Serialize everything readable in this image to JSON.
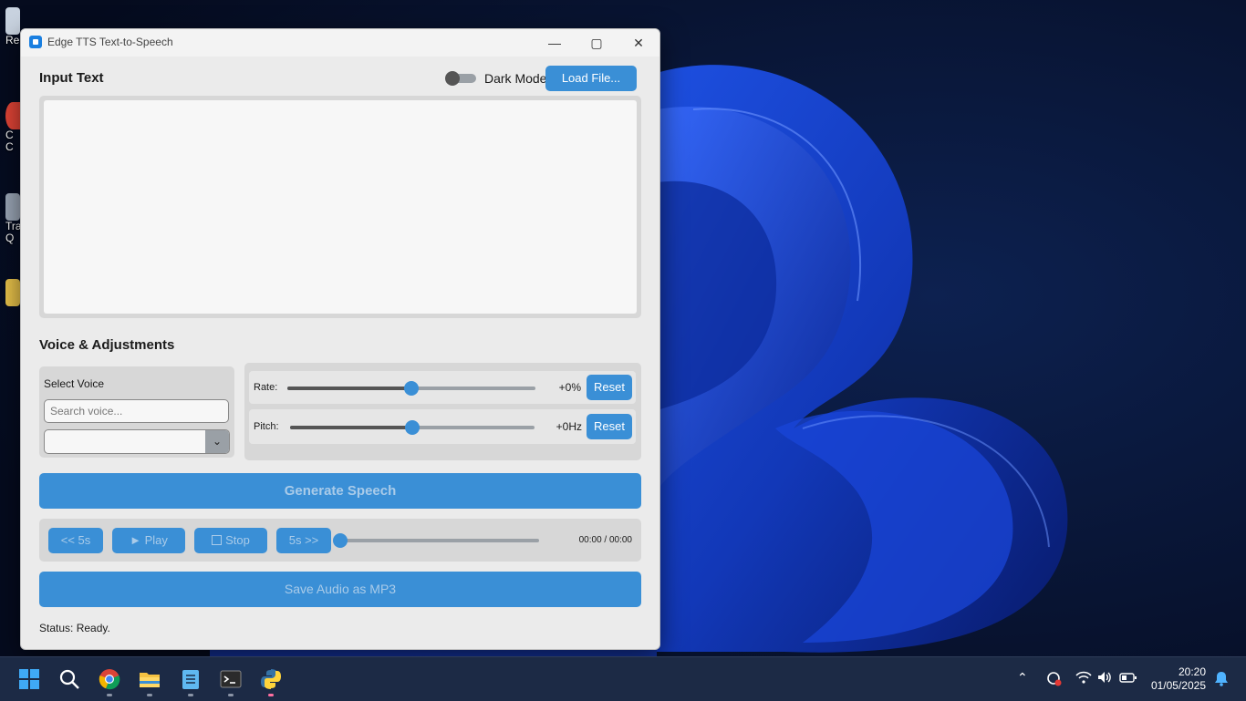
{
  "window": {
    "title": "Edge TTS Text-to-Speech",
    "minimize_glyph": "—",
    "maximize_glyph": "▢",
    "close_glyph": "✕"
  },
  "input_section": {
    "title": "Input Text",
    "dark_mode_label": "Dark Mode",
    "dark_mode_on": false,
    "load_file_label": "Load File...",
    "text_value": ""
  },
  "voice_section": {
    "title": "Voice & Adjustments",
    "select_voice_label": "Select Voice",
    "search_placeholder": "Search voice...",
    "selected_voice": "",
    "rate": {
      "label": "Rate:",
      "value": "+0%",
      "reset_label": "Reset",
      "level": 0.5
    },
    "pitch": {
      "label": "Pitch:",
      "value": "+0Hz",
      "reset_label": "Reset",
      "level": 0.5
    }
  },
  "generate_label": "Generate Speech",
  "playback": {
    "back_label": "<< 5s",
    "play_label": "► Play",
    "stop_label": "Stop",
    "forward_label": "5s >>",
    "time": "00:00 / 00:00",
    "progress": 0
  },
  "save_label": "Save Audio as MP3",
  "status_text": "Status: Ready.",
  "desktop_labels": {
    "recycle": "Re",
    "chrome": "C\nC",
    "transfer": "Tra\nQ"
  },
  "taskbar": {
    "apps": [
      "start-icon",
      "search-icon",
      "chrome-icon",
      "file-explorer-icon",
      "notepad-icon",
      "terminal-icon",
      "python-icon"
    ],
    "time": "20:20",
    "date": "01/05/2025"
  },
  "colors": {
    "accent": "#3a8fd6",
    "window_bg": "#ebebeb",
    "panel_bg": "#d7d7d7"
  }
}
